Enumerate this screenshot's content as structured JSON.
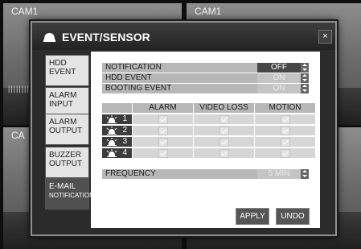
{
  "cameras": [
    {
      "label": "CAM1",
      "city": "||||||||||| ||||||||||"
    },
    {
      "label": "CAM1",
      "city": ""
    },
    {
      "label": "CA",
      "city": ""
    },
    {
      "label": "",
      "city": ""
    }
  ],
  "dialog": {
    "title": "EVENT/SENSOR",
    "close": "×",
    "title_icon": "bell-icon"
  },
  "tabs": [
    {
      "line1": "HDD",
      "line2": "EVENT",
      "selected": false
    },
    {
      "line1": "ALARM",
      "line2": "INPUT",
      "selected": false
    },
    {
      "line1": "ALARM",
      "line2": "OUTPUT",
      "selected": false
    },
    {
      "line1": "BUZZER",
      "line2": "OUTPUT",
      "selected": false
    },
    {
      "line1": "E-MAIL",
      "line2": "NOTIFICATION",
      "selected": true
    }
  ],
  "settings": {
    "notification": {
      "label": "NOTIFICATION",
      "value": "OFF"
    },
    "hdd_event": {
      "label": "HDD EVENT",
      "value": "ON"
    },
    "booting_event": {
      "label": "BOOTING EVENT",
      "value": "ON"
    }
  },
  "grid": {
    "headers": [
      "ALARM",
      "VIDEO LOSS",
      "MOTION"
    ],
    "rows": [
      {
        "channel": "1"
      },
      {
        "channel": "2"
      },
      {
        "channel": "3"
      },
      {
        "channel": "4"
      }
    ]
  },
  "frequency": {
    "label": "FREQUENCY",
    "value": "5 MIN"
  },
  "buttons": {
    "apply": "APPLY",
    "undo": "UNDO"
  },
  "colors": {
    "panel": "#ffffff",
    "row": "#b7b7b7",
    "selected_value": "#474747",
    "channel": "#3c3c3c"
  }
}
